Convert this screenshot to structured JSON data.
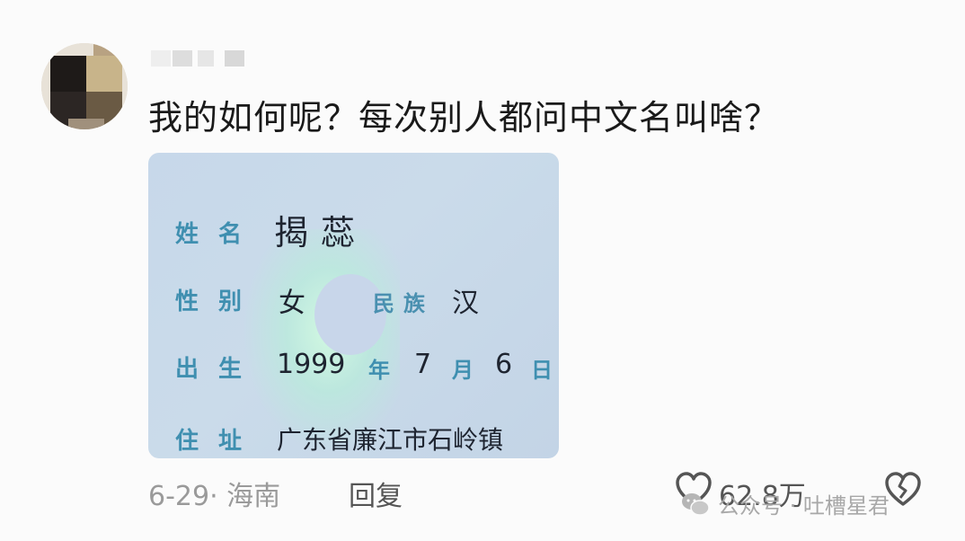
{
  "comment": {
    "text": "我的如何呢？每次别人都问中文名叫啥？"
  },
  "id_card": {
    "name_label": "姓名",
    "name_value": "揭蕊",
    "gender_label": "性别",
    "gender_value": "女",
    "ethnicity_label": "民族",
    "ethnicity_value": "汉",
    "birth_label": "出生",
    "birth_year": "1999",
    "birth_year_unit": "年",
    "birth_month": "7",
    "birth_month_unit": "月",
    "birth_day": "6",
    "birth_day_unit": "日",
    "address_label": "住址",
    "address_value": "广东省廉江市石岭镇"
  },
  "footer": {
    "meta": "6-29· 海南",
    "reply_label": "回复",
    "like_count": "62.8万"
  },
  "watermark": {
    "text": "公众号 · 吐槽星君"
  },
  "icons": {
    "like": "heart-icon",
    "dislike": "broken-heart-icon",
    "watermark_logo": "wechat-icon"
  }
}
